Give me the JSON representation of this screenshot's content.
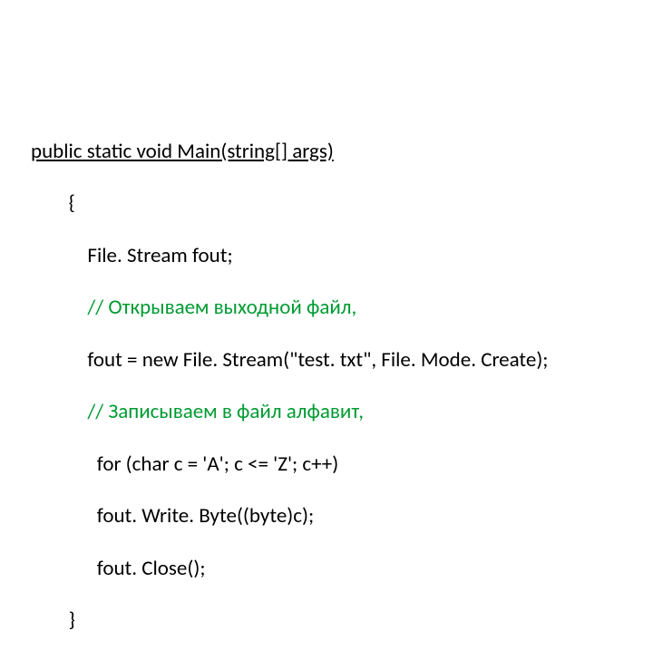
{
  "code": {
    "line1": "public static void Main(string[] args)",
    "line2": "        {",
    "line3_plain": "            File. Stream fout;",
    "line4_comment": "            // Открываем выходной файл,",
    "line5_plain": "            fout = new File. Stream(\"test. txt\", File. Mode. Create);",
    "line6_comment": "            // Записываем в файл алфавит,",
    "line7_plain": "              for (char с = 'A'; с <= 'Z'; с++)",
    "line8_plain": "              fout. Write. Byte((byte)с);",
    "line9_plain": "              fout. Close();",
    "line10": "        }"
  }
}
